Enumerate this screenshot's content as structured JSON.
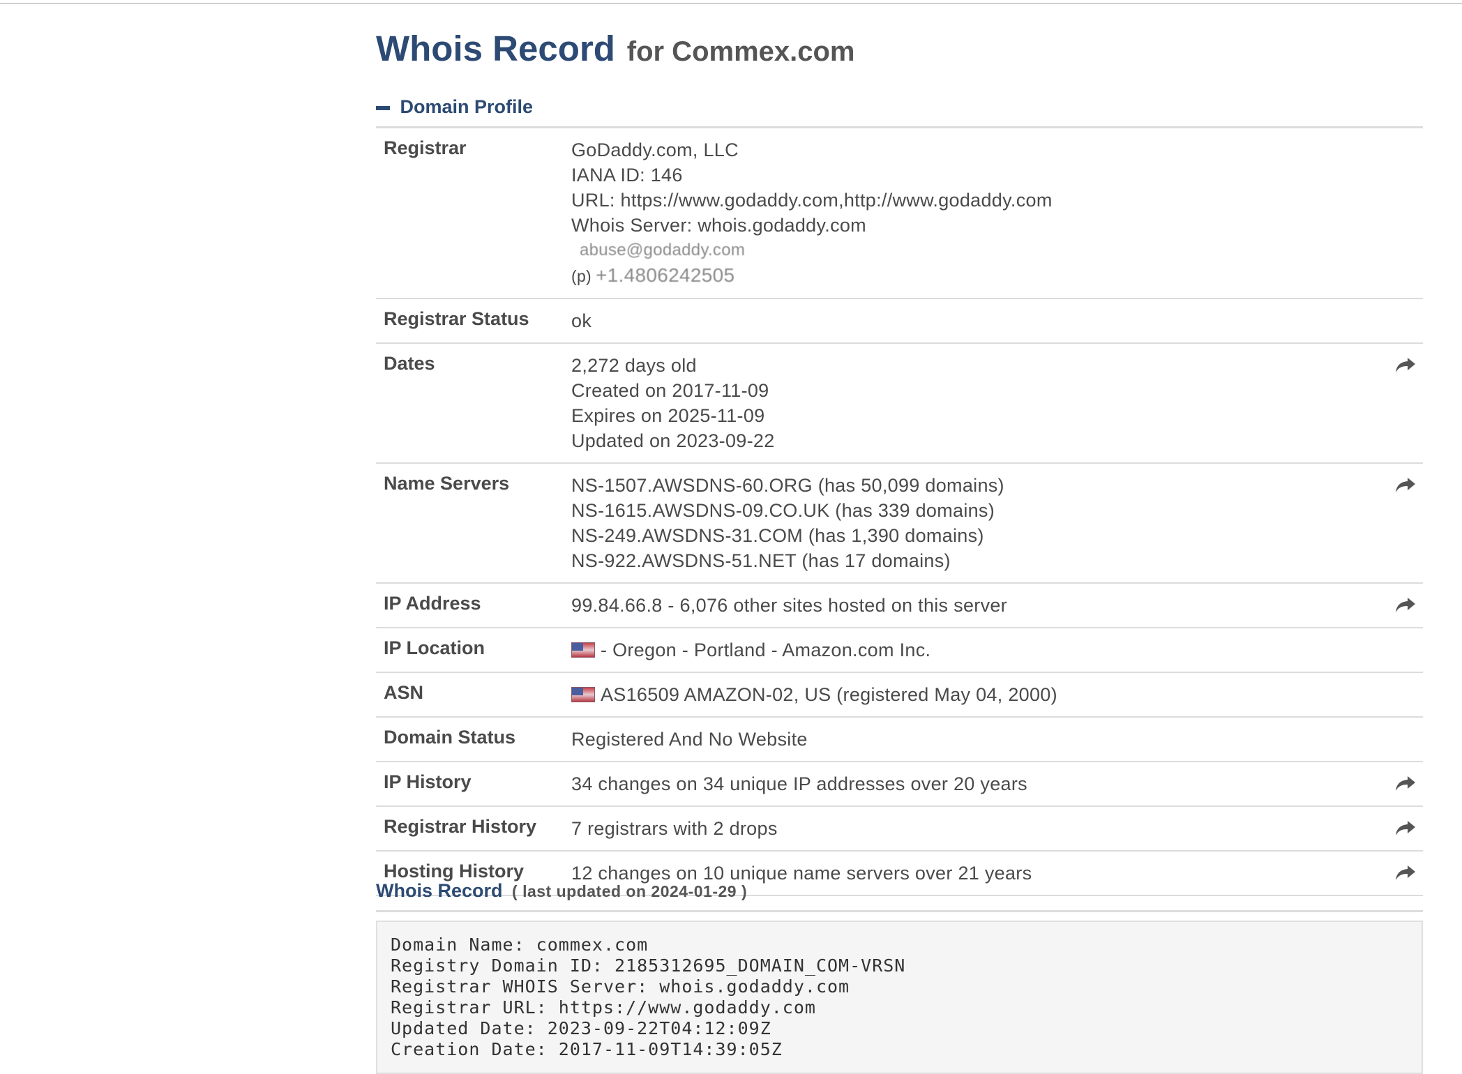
{
  "title": {
    "main": "Whois Record",
    "sub": "for Commex.com"
  },
  "profile": {
    "heading": "Domain Profile",
    "rows": [
      {
        "label": "Registrar",
        "lines": [
          "GoDaddy.com, LLC",
          "IANA ID: 146",
          "URL: https://www.godaddy.com,http://www.godaddy.com",
          "Whois Server: whois.godaddy.com"
        ],
        "email": "abuse@godaddy.com",
        "phone_prefix": "(p)",
        "phone": "+1.4806242505"
      },
      {
        "label": "Registrar Status",
        "lines": [
          "ok"
        ]
      },
      {
        "label": "Dates",
        "lines": [
          "2,272 days old",
          "Created on 2017-11-09",
          "Expires on 2025-11-09",
          "Updated on 2023-09-22"
        ],
        "action_icon": "share-arrow-icon"
      },
      {
        "label": "Name Servers",
        "lines": [
          "NS-1507.AWSDNS-60.ORG (has 50,099 domains)",
          "NS-1615.AWSDNS-09.CO.UK (has 339 domains)",
          "NS-249.AWSDNS-31.COM (has 1,390 domains)",
          "NS-922.AWSDNS-51.NET (has 17 domains)"
        ],
        "action_icon": "share-arrow-icon"
      },
      {
        "label": "IP Address",
        "lines": [
          "99.84.66.8 - 6,076 other sites hosted on this server"
        ],
        "action_icon": "share-arrow-icon"
      },
      {
        "label": "IP Location",
        "lines": [
          "- Oregon - Portland - Amazon.com Inc."
        ],
        "flag_icon": "us-flag-icon"
      },
      {
        "label": "ASN",
        "lines": [
          "AS16509 AMAZON-02, US (registered May 04, 2000)"
        ],
        "flag_icon": "us-flag-icon"
      },
      {
        "label": "Domain Status",
        "lines": [
          "Registered And No Website"
        ]
      },
      {
        "label": "IP History",
        "lines": [
          "34 changes on 34 unique IP addresses over 20 years"
        ],
        "action_icon": "share-arrow-icon"
      },
      {
        "label": "Registrar History",
        "lines": [
          "7 registrars with 2 drops"
        ],
        "action_icon": "share-arrow-icon"
      },
      {
        "label": "Hosting History",
        "lines": [
          "12 changes on 10 unique name servers over 21 years"
        ],
        "action_icon": "share-arrow-icon"
      }
    ]
  },
  "whois_record": {
    "heading": "Whois Record",
    "updated_note": "( last updated on 2024-01-29 )",
    "raw_lines": [
      "Domain Name: commex.com",
      "Registry Domain ID: 2185312695_DOMAIN_COM-VRSN",
      "Registrar WHOIS Server: whois.godaddy.com",
      "Registrar URL: https://www.godaddy.com",
      "Updated Date: 2023-09-22T04:12:09Z",
      "Creation Date: 2017-11-09T14:39:05Z"
    ]
  },
  "colors": {
    "accent": "#2c4a73",
    "text": "#4a4a4a",
    "rule": "#dcdcdc",
    "raw_bg": "#f5f5f5"
  }
}
